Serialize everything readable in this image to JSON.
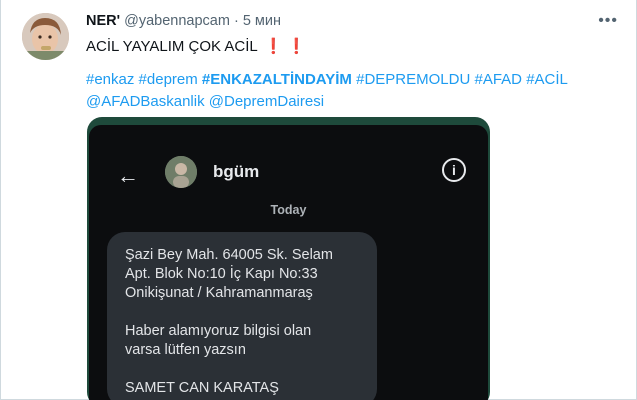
{
  "author": {
    "display_name": "NER'",
    "handle": "@yabennapcam",
    "separator": "·",
    "time": "5 мин"
  },
  "more_label": "•••",
  "tweet": {
    "text": "ACİL YAYALIM ÇOK ACİL",
    "emphasis": "❗ ❗",
    "tags_line1": [
      {
        "text": "#enkaz",
        "bold": false
      },
      {
        "text": "#deprem",
        "bold": false
      },
      {
        "text": "#ENKAZALTİNDAYİM",
        "bold": true
      },
      {
        "text": "#DEPREMOLDU",
        "bold": false
      },
      {
        "text": "#AFAD",
        "bold": false
      },
      {
        "text": "#ACİL",
        "bold": false
      }
    ],
    "tags_line2": [
      {
        "text": "@AFADBaskanlik",
        "bold": false
      },
      {
        "text": "@DepremDairesi",
        "bold": false
      }
    ]
  },
  "media": {
    "back_icon": "←",
    "contact_name": "bgüm",
    "info_icon": "i",
    "date_label": "Today",
    "message_lines": [
      "Şazi Bey Mah. 64005 Sk. Selam",
      "Apt. Blok No:10 İç Kapı No:33",
      "Onikişunat / Kahramanmaraş",
      "",
      "Haber alamıyoruz bilgisi olan",
      "varsa lütfen yazsın",
      "",
      "SAMET CAN KARATAŞ"
    ]
  },
  "colors": {
    "link": "#1d9bf0",
    "text": "#0f1419",
    "muted": "#536471",
    "alert": "#d6112c",
    "media_bg": "#1e4a3b",
    "phone_bg": "#0c0d0f",
    "bubble_bg": "#2b3036"
  },
  "icons": [
    "avatar",
    "more-icon",
    "back-arrow-icon",
    "contact-avatar",
    "info-icon"
  ]
}
